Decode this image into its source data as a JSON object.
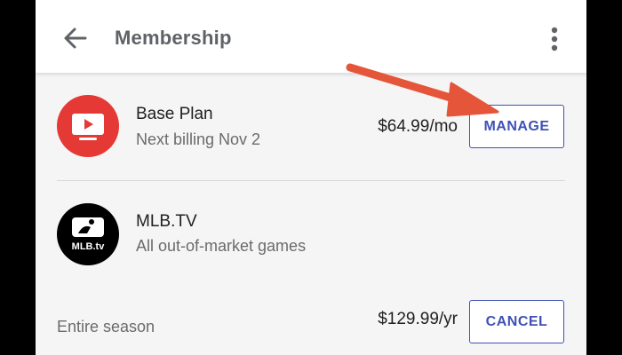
{
  "header": {
    "title": "Membership",
    "back_icon": "arrow-back-icon",
    "menu_icon": "more-vert-icon"
  },
  "subscriptions": [
    {
      "name": "Base Plan",
      "detail": "Next billing Nov 2",
      "price": "$64.99/mo",
      "action": "MANAGE",
      "logo": "youtube-tv-icon"
    },
    {
      "name": "MLB.TV",
      "detail": "All out-of-market games",
      "term": "Entire season",
      "price": "$129.99/yr",
      "action": "CANCEL",
      "logo": "mlb-tv-logo",
      "logo_text": "MLB.tv"
    }
  ],
  "colors": {
    "accent": "#3f51b5",
    "youtube_red": "#e53935",
    "annotation_arrow": "#e5553a"
  }
}
